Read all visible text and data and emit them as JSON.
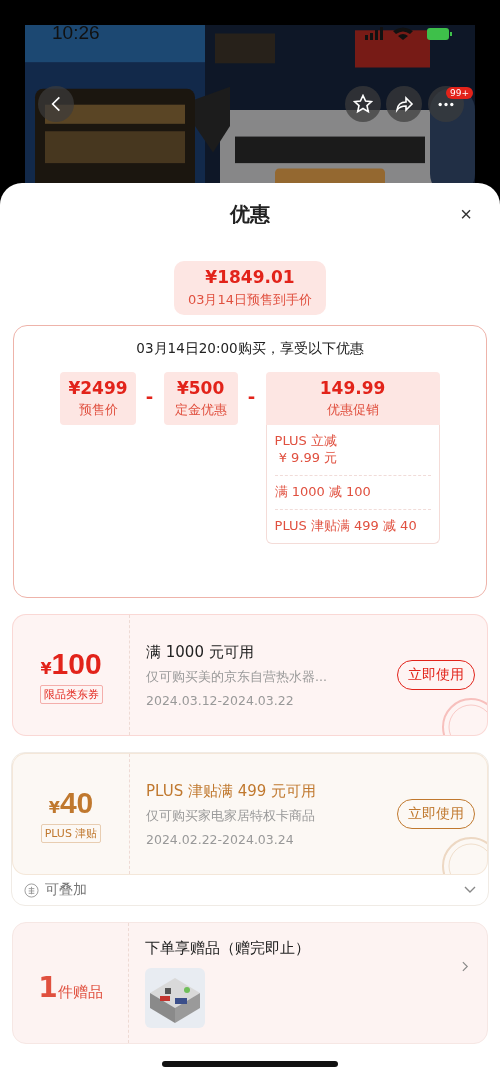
{
  "status_bar": {
    "time": "10:26"
  },
  "nav": {
    "badge": "99+"
  },
  "sheet": {
    "title": "优惠",
    "close": "×"
  },
  "final_price": {
    "amount": "¥1849.01",
    "label": "03月14日预售到手价"
  },
  "breakdown": {
    "heading": "03月14日20:00购买，享受以下优惠",
    "items": [
      {
        "amount": "¥2499",
        "label": "预售价"
      },
      {
        "amount": "¥500",
        "label": "定金优惠"
      },
      {
        "amount": "149.99",
        "label": "优惠促销"
      }
    ],
    "operator": "-",
    "promotions": [
      "PLUS 立减\n ¥ 9.99 元",
      "满 1000 减 100",
      "PLUS 津贴满 499 减 40"
    ]
  },
  "coupons": [
    {
      "currency": "¥",
      "amount": "100",
      "tag": "限品类东券",
      "title": "满 1000 元可用",
      "desc": "仅可购买美的京东自营热水器...",
      "dates": "2024.03.12-2024.03.22",
      "button": "立即使用",
      "color": "#e2231a"
    },
    {
      "currency": "¥",
      "amount": "40",
      "tag": "PLUS 津贴",
      "title": "PLUS 津贴满 499 元可用",
      "desc": "仅可购买家电家居特权卡商品",
      "dates": "2024.02.22-2024.03.24",
      "button": "立即使用",
      "color": "#c0782e"
    }
  ],
  "stack": {
    "label": "可叠加",
    "expanded": false
  },
  "gift": {
    "count": "1",
    "unit": "件赠品",
    "title": "下单享赠品（赠完即止）"
  }
}
